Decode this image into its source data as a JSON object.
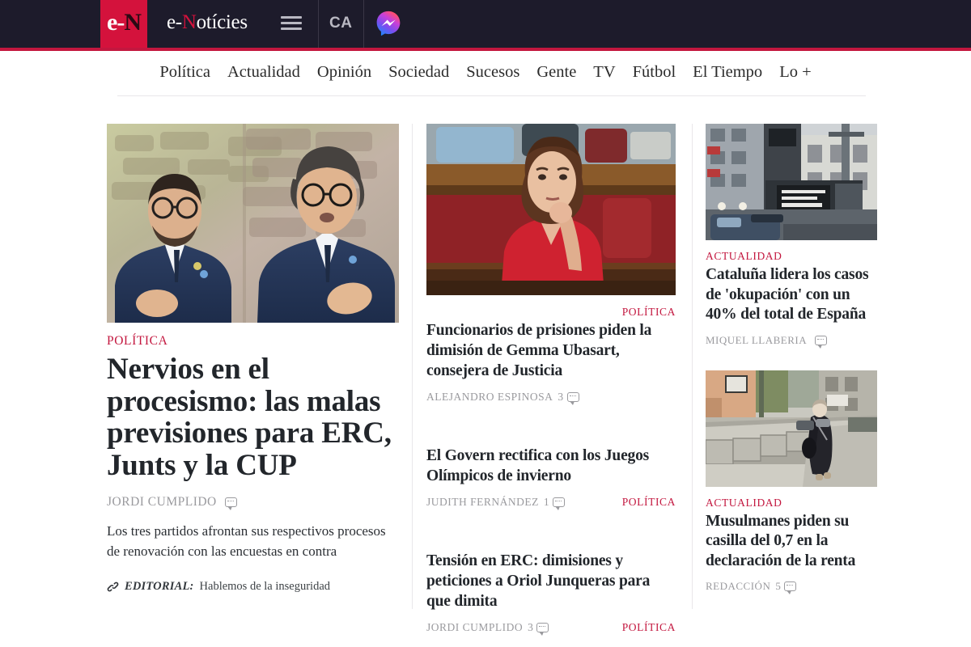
{
  "site": {
    "logo_mark": "e-N",
    "logo_mark_e": "e",
    "logo_mark_dash": "-",
    "logo_mark_n": "N",
    "wordmark_pre": "e-",
    "wordmark_n": "N",
    "wordmark_post": "otícies",
    "language_button": "CA",
    "menu_icon": "hamburger-menu-icon",
    "messenger_icon": "facebook-messenger-icon",
    "accent_red": "#c3173f",
    "logo_red": "#d4123c",
    "header_bg": "#1d1b2b"
  },
  "nav": {
    "items": [
      "Política",
      "Actualidad",
      "Opinión",
      "Sociedad",
      "Sucesos",
      "Gente",
      "TV",
      "Fútbol",
      "El Tiempo",
      "Lo +"
    ]
  },
  "lead": {
    "image_alt": "Dos políticos con traje azul frente a un muro de piedra",
    "kicker": "POLÍTICA",
    "headline": "Nervios en el procesismo: las malas previsiones para ERC, Junts y la CUP",
    "author": "JORDI CUMPLIDO",
    "comments": "",
    "summary": "Los tres partidos afrontan sus respectivos procesos de renovación con las encuestas en contra",
    "editorial_label": "EDITORIAL:",
    "editorial_text": "Hablemos de la inseguridad",
    "editorial_icon": "link-clip-icon"
  },
  "center": {
    "image_alt": "Mujer con chaqueta roja sentada en el parlamento",
    "articles": [
      {
        "kicker": "POLÍTICA",
        "kicker_position": "top-right",
        "headline": "Funcionarios de prisiones piden la dimisión de Gemma Ubasart, consejera de Justicia",
        "author": "ALEJANDRO ESPINOSA",
        "comments": "3"
      },
      {
        "kicker": "POLÍTICA",
        "kicker_position": "bottom-right",
        "headline": "El Govern rectifica con los Juegos Olímpicos de invierno",
        "author": "JUDITH FERNÁNDEZ",
        "comments": "1"
      },
      {
        "kicker": "POLÍTICA",
        "kicker_position": "bottom-right",
        "headline": "Tensión en ERC: dimisiones y peticiones a Oriol Junqueras para que dimita",
        "author": "JORDI CUMPLIDO",
        "comments": "3"
      }
    ]
  },
  "right": {
    "articles": [
      {
        "image_alt": "Edificio okupado con pancartas y furgonetas policiales",
        "kicker": "ACTUALIDAD",
        "headline": "Cataluña lidera los casos de 'okupación' con un 40% del total de España",
        "author": "MIQUEL LLABERIA",
        "comments": ""
      },
      {
        "image_alt": "Mujer con vestimenta larga oscura caminando por una acera",
        "kicker": "ACTUALIDAD",
        "headline": "Musulmanes piden su casilla del 0,7 en la declaración de la renta",
        "author": "REDACCIÓN",
        "comments": "5"
      }
    ]
  }
}
